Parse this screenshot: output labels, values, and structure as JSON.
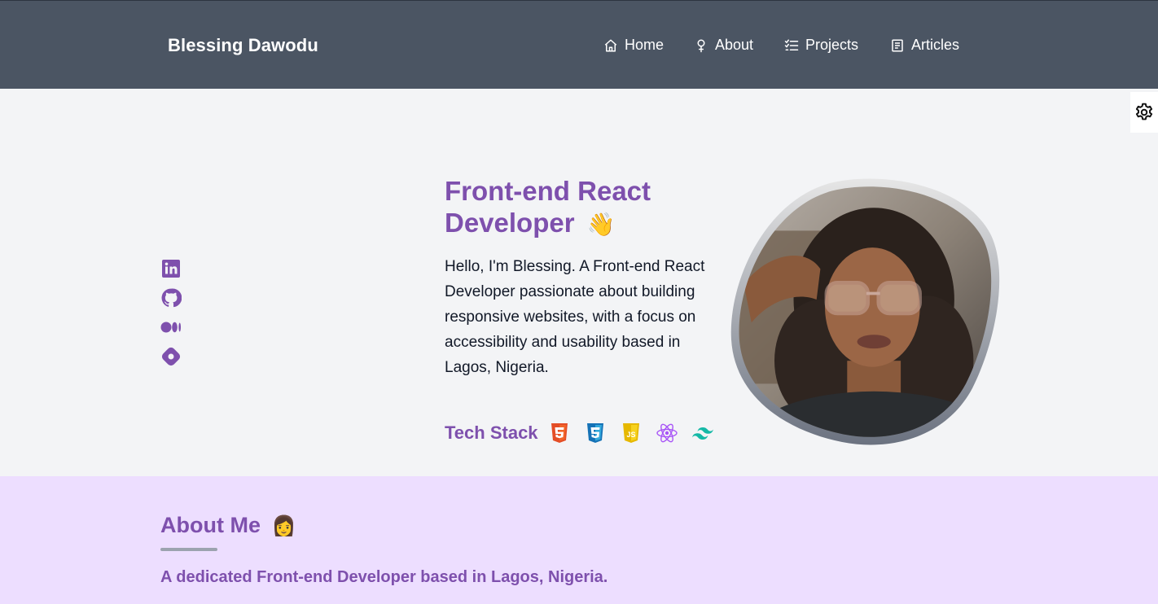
{
  "header": {
    "brand": "Blessing Dawodu",
    "nav": [
      {
        "label": "Home",
        "icon": "home-icon"
      },
      {
        "label": "About",
        "icon": "person-icon"
      },
      {
        "label": "Projects",
        "icon": "checklist-icon"
      },
      {
        "label": "Articles",
        "icon": "article-icon"
      }
    ]
  },
  "settings": {
    "icon": "gear-icon"
  },
  "socials": [
    "linkedin-icon",
    "github-icon",
    "medium-icon",
    "hashnode-icon"
  ],
  "hero": {
    "title_line1": "Front-end React",
    "title_line2": "Developer",
    "wave_emoji": "👋",
    "description": "Hello, I'm Blessing. A Front-end React Developer passionate about building responsive websites, with a focus on accessibility and usability based in Lagos, Nigeria.",
    "tech_stack_label": "Tech Stack",
    "tech_icons": [
      "html5-icon",
      "css3-icon",
      "javascript-icon",
      "react-icon",
      "tailwind-icon"
    ]
  },
  "about": {
    "title": "About Me",
    "emoji": "👩",
    "subtitle": "A dedicated Front-end Developer based in Lagos, Nigeria."
  },
  "colors": {
    "header_bg": "#4b5563",
    "accent": "#7e50ad",
    "page_bg": "#f3f4f6",
    "about_bg": "#eddeff"
  }
}
